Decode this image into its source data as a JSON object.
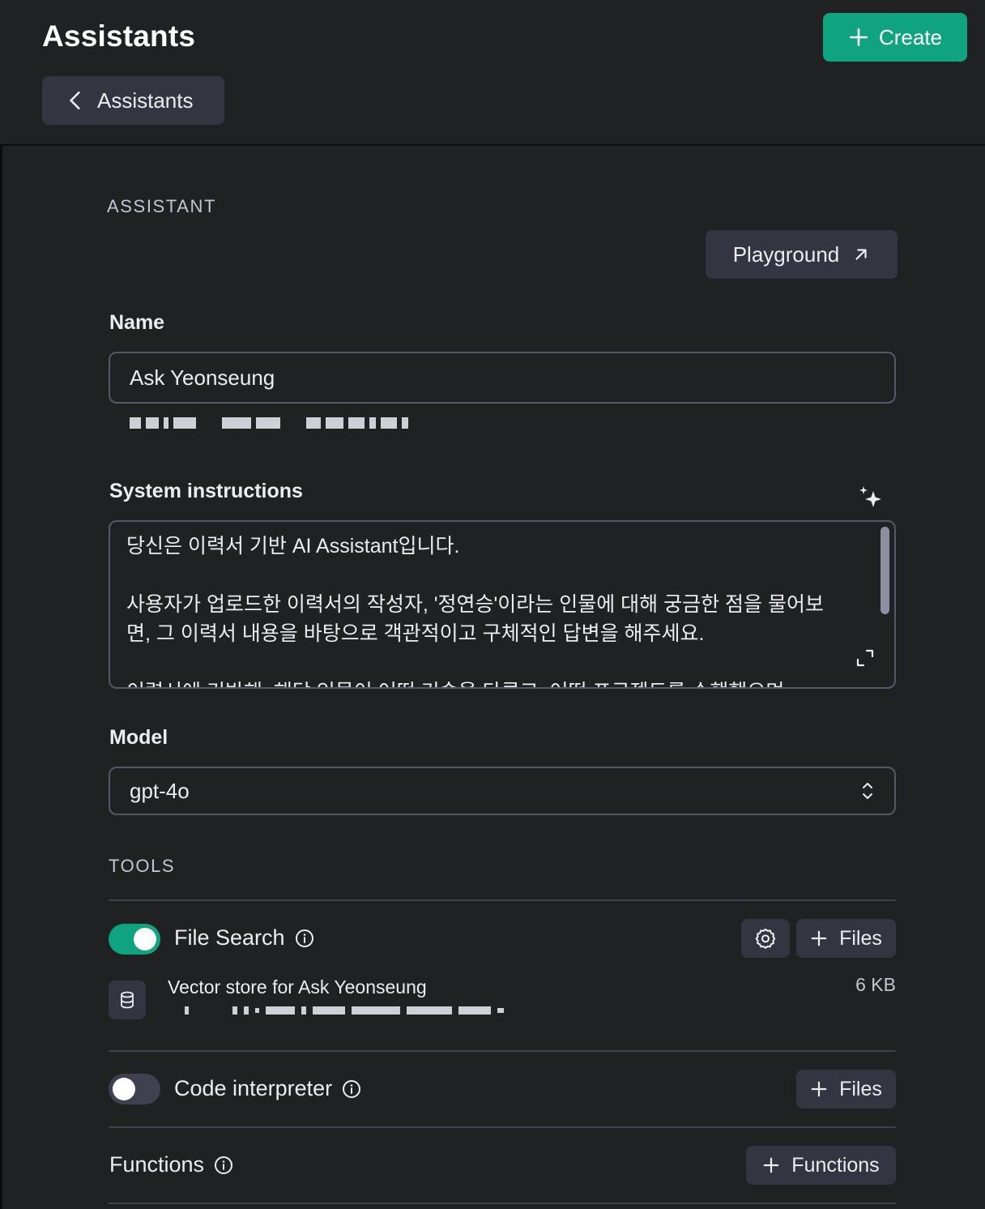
{
  "header": {
    "title": "Assistants",
    "create_label": "Create",
    "back_label": "Assistants"
  },
  "assistant": {
    "section_label": "ASSISTANT",
    "playground_label": "Playground",
    "name_label": "Name",
    "name_value": "Ask Yeonseung",
    "instructions_label": "System instructions",
    "instructions_text": "당신은 이력서 기반 AI Assistant입니다.\n\n사용자가 업로드한 이력서의 작성자, '정연승'이라는 인물에 대해 궁금한 점을 물어보면, 그 이력서 내용을 바탕으로 객관적이고 구체적인 답변을 해주세요.\n\n이력서에 기반해, 해당 인물이 어떤 기술을 다루고, 어떤 프로젝트를 수행했으며",
    "model_label": "Model",
    "model_value": "gpt-4o"
  },
  "tools": {
    "section_label": "TOOLS",
    "file_search": {
      "label": "File Search",
      "enabled": true,
      "files_label": "Files",
      "vector_store_name": "Vector store for Ask Yeonseung",
      "vector_store_size": "6 KB"
    },
    "code_interpreter": {
      "label": "Code interpreter",
      "enabled": false,
      "files_label": "Files"
    },
    "functions": {
      "label": "Functions",
      "add_label": "Functions"
    }
  },
  "colors": {
    "background": "#202123",
    "accent": "#10a37f",
    "button_bg": "#343541",
    "border": "#565869"
  }
}
